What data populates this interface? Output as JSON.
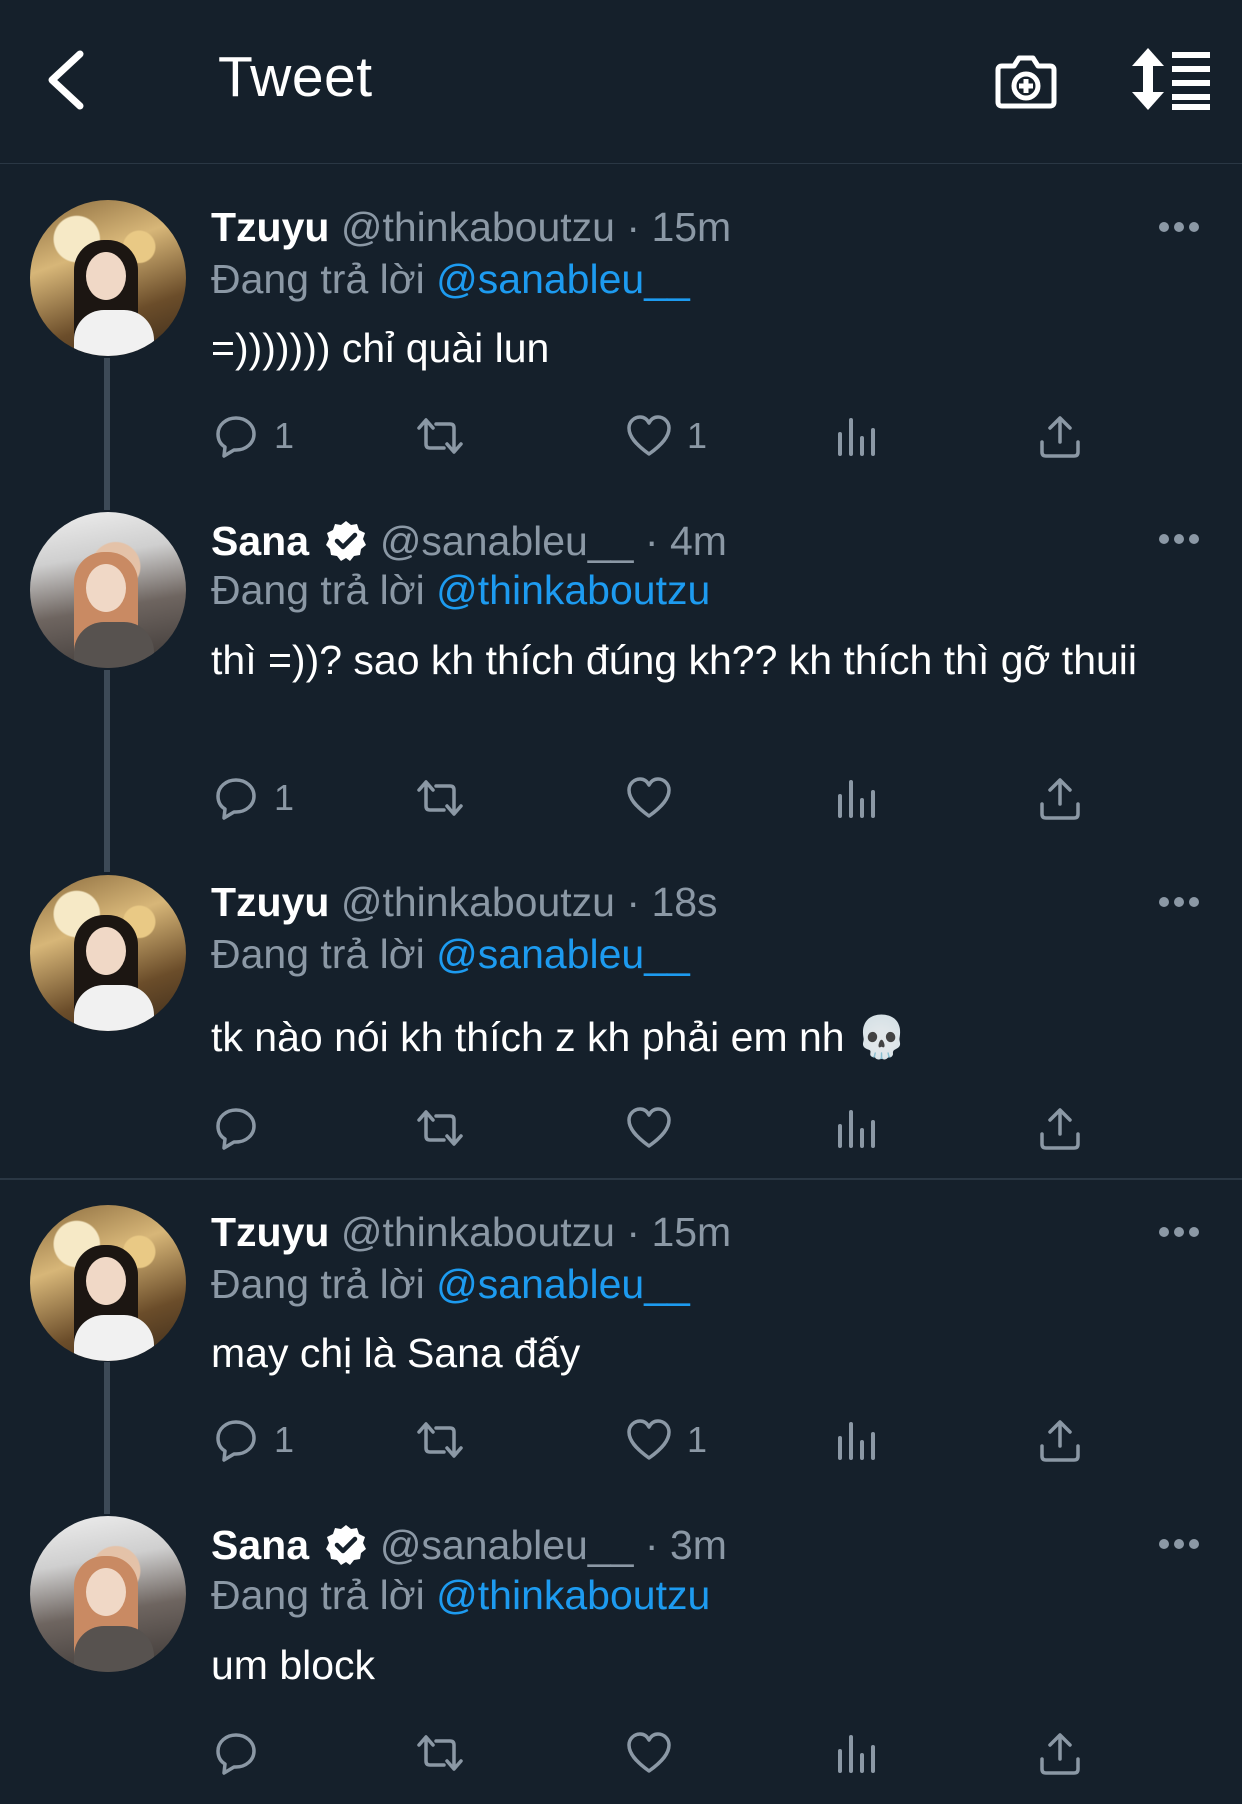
{
  "header": {
    "title": "Tweet"
  },
  "icons": {
    "back": "chevron-left-icon",
    "camera": "camera-plus-icon",
    "sort": "sort-list-icon",
    "verified": "verified-badge-icon",
    "more": "more-dots-icon",
    "reply": "comment-icon",
    "retweet": "retweet-icon",
    "like": "heart-icon",
    "stats": "analytics-icon",
    "share": "share-icon"
  },
  "colors": {
    "background": "#15202b",
    "muted": "#8b98a5",
    "accent": "#1d9bf0"
  },
  "tweets": [
    {
      "name": "Tzuyu",
      "verified": false,
      "handle": "@thinkaboutzu",
      "dot": "·",
      "time": "15m",
      "reply_prefix": "Đang trả lời",
      "reply_to": "@sanableu__",
      "text": "=))))))) chỉ quài lun",
      "replies": "1",
      "likes": "1"
    },
    {
      "name": "Sana",
      "verified": true,
      "handle": "@sanableu__",
      "dot": "·",
      "time": "4m",
      "reply_prefix": "Đang trả lời",
      "reply_to": "@thinkaboutzu",
      "text": "thì =))? sao kh thích đúng kh?? kh thích thì gỡ thuii",
      "replies": "1",
      "likes": ""
    },
    {
      "name": "Tzuyu",
      "verified": false,
      "handle": "@thinkaboutzu",
      "dot": "·",
      "time": "18s",
      "reply_prefix": "Đang trả lời",
      "reply_to": "@sanableu__",
      "text": "tk nào nói kh thích z kh phải em nh 💀",
      "replies": "",
      "likes": ""
    },
    {
      "name": "Tzuyu",
      "verified": false,
      "handle": "@thinkaboutzu",
      "dot": "·",
      "time": "15m",
      "reply_prefix": "Đang trả lời",
      "reply_to": "@sanableu__",
      "text": "may chị là Sana đấy",
      "replies": "1",
      "likes": "1"
    },
    {
      "name": "Sana",
      "verified": true,
      "handle": "@sanableu__",
      "dot": "·",
      "time": "3m",
      "reply_prefix": "Đang trả lời",
      "reply_to": "@thinkaboutzu",
      "text": "um block",
      "replies": "",
      "likes": ""
    }
  ]
}
